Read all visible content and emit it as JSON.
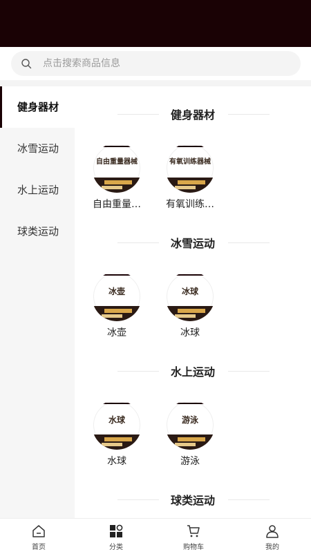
{
  "search": {
    "placeholder": "点击搜索商品信息"
  },
  "sidebar": {
    "items": [
      {
        "label": "健身器材",
        "active": true
      },
      {
        "label": "冰雪运动"
      },
      {
        "label": "水上运动"
      },
      {
        "label": "球类运动"
      }
    ]
  },
  "sections": [
    {
      "title": "健身器材",
      "items": [
        {
          "name": "自由重量…",
          "thumb_text": "自由重量器械"
        },
        {
          "name": "有氧训练…",
          "thumb_text": "有氧训练器械"
        }
      ]
    },
    {
      "title": "冰雪运动",
      "items": [
        {
          "name": "冰壶",
          "thumb_text": "冰壶"
        },
        {
          "name": "冰球",
          "thumb_text": "冰球"
        }
      ]
    },
    {
      "title": "水上运动",
      "items": [
        {
          "name": "水球",
          "thumb_text": "水球"
        },
        {
          "name": "游泳",
          "thumb_text": "游泳"
        }
      ]
    },
    {
      "title": "球类运动",
      "items": []
    }
  ],
  "tabbar": {
    "items": [
      {
        "label": "首页",
        "icon": "home-icon"
      },
      {
        "label": "分类",
        "icon": "category-icon"
      },
      {
        "label": "购物车",
        "icon": "cart-icon"
      },
      {
        "label": "我的",
        "icon": "user-icon"
      }
    ]
  },
  "colors": {
    "header": "#1a0205",
    "sidebar_bg": "#f6f6f6"
  }
}
